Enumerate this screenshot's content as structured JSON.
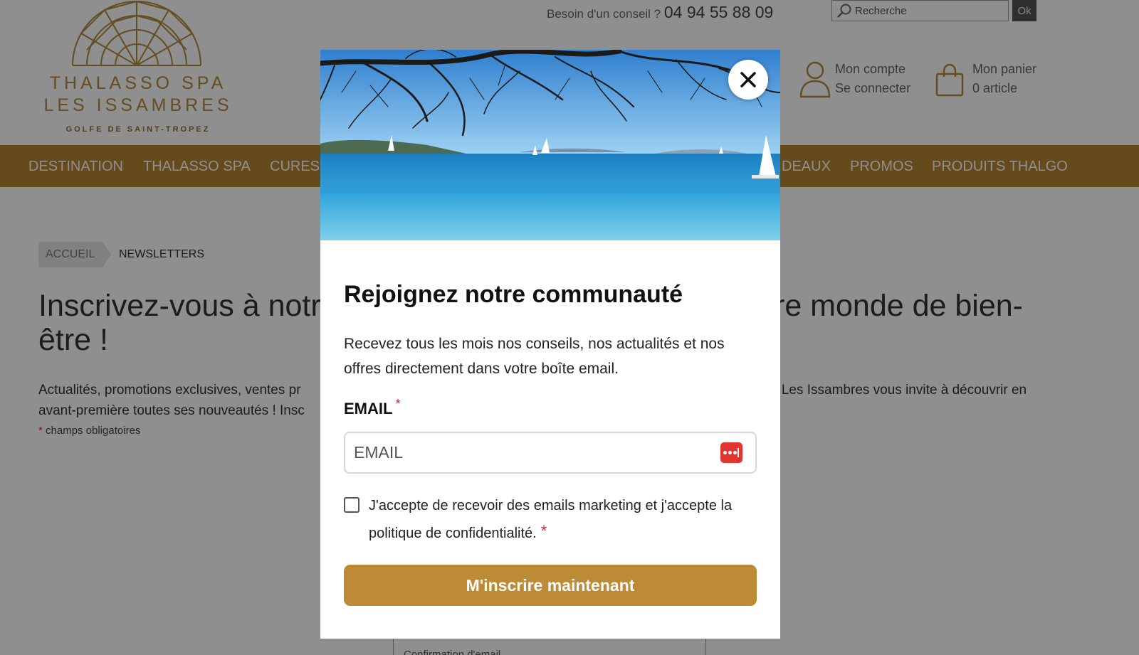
{
  "header": {
    "logo": {
      "line1": "THALASSO SPA",
      "line2": "LES ISSAMBRES",
      "line3": "GOLFE DE SAINT-TROPEZ",
      "color": "#b08a3e"
    },
    "conseil_label": "Besoin d'un conseil ?",
    "phone": "04 94 55 88 09",
    "search": {
      "placeholder": "Recherche",
      "button_label": "Ok",
      "icon": "search-icon"
    },
    "account": {
      "line1": "Mon compte",
      "line2": "Se connecter",
      "icon": "user-icon"
    },
    "cart": {
      "line1": "Mon panier",
      "line2": "0 article",
      "icon": "shopping-bag-icon"
    }
  },
  "nav": {
    "background": "#b48632",
    "items": [
      "DESTINATION",
      "THALASSO SPA",
      "CURES",
      "DEAUX",
      "PROMOS",
      "PRODUITS THALGO"
    ]
  },
  "breadcrumb": {
    "home": "ACCUEIL",
    "current": "NEWSLETTERS"
  },
  "main": {
    "heading_left": "Inscrivez-vous à notr",
    "heading_left_line2": "être !",
    "heading_right": "re monde de bien-",
    "intro_left_1": "Actualités, promotions exclusives, ventes pr",
    "intro_left_2": "avant-première toutes ses nouveautés ! Insc",
    "intro_right": "a Les Issambres vous invite à découvrir en",
    "required_star": "*",
    "required_note": "champs obligatoires",
    "confirm_email_placeholder": "Confirmation d'email"
  },
  "modal": {
    "close_icon": "close-icon",
    "title": "Rejoignez notre communauté",
    "description": "Recevez tous les mois nos conseils, nos actualités et nos offres directement dans votre boîte email.",
    "email_label": "EMAIL",
    "required_mark": "*",
    "email_placeholder": "EMAIL",
    "password_manager_icon": "password-manager-icon",
    "consent_line1": "J'accepte de recevoir des emails marketing et j'accepte la",
    "consent_line2": "politique de confidentialité.",
    "consent_checked": false,
    "submit_label": "M'inscrire maintenant",
    "accent": "#bd8a35"
  }
}
